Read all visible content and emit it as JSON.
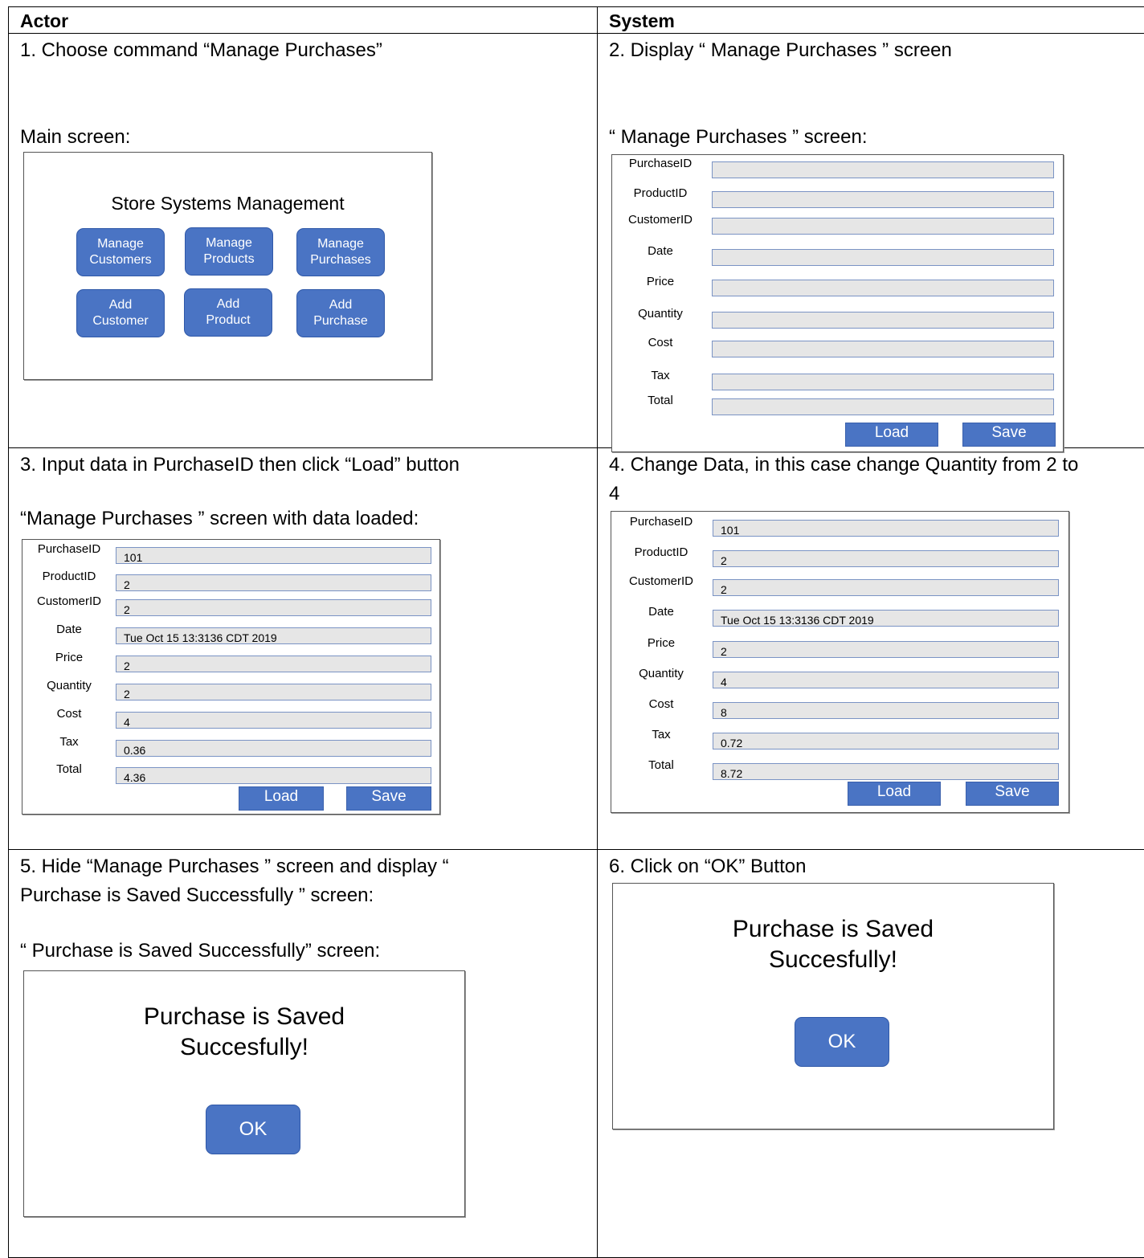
{
  "headers": {
    "actor": "Actor",
    "system": "System"
  },
  "steps": {
    "s1": "1. Choose command “Manage Purchases”",
    "s2": "2. Display “ Manage   Purchases ” screen",
    "s3": "3. Input data in PurchaseID then click “Load” button",
    "s4_line1": "4. Change Data, in this case change Quantity from 2 to",
    "s4_line2": "4",
    "s5_line1": "5. Hide “Manage   Purchases ” screen and display “",
    "s5_line2": "Purchase is Saved Successfully ” screen:",
    "s6": "6. Click on “OK” Button"
  },
  "captions": {
    "main": "Main screen:",
    "manage": "“ Manage   Purchases ” screen:",
    "loaded": "“Manage   Purchases ” screen with data loaded:",
    "saved": "“  Purchase is Saved Successfully” screen:"
  },
  "main_screen": {
    "title": "Store Systems Management",
    "buttons": {
      "manage_customers": "Manage\nCustomers",
      "manage_products": "Manage\nProducts",
      "manage_purchases": "Manage\nPurchases",
      "add_customer": "Add\nCustomer",
      "add_product": "Add\nProduct",
      "add_purchase": "Add\nPurchase"
    }
  },
  "form_labels": {
    "purchase_id": "PurchaseID",
    "product_id": "ProductID",
    "customer_id": "CustomerID",
    "date": "Date",
    "price": "Price",
    "quantity": "Quantity",
    "cost": "Cost",
    "tax": "Tax",
    "total": "Total",
    "load": "Load",
    "save": "Save"
  },
  "loaded_values": {
    "purchase_id": "101",
    "product_id": "2",
    "customer_id": "2",
    "date": "Tue Oct 15 13:3136 CDT 2019",
    "price": "2",
    "quantity": "2",
    "cost": "4",
    "tax": "0.36",
    "total": "4.36"
  },
  "changed_values": {
    "purchase_id": "101",
    "product_id": "2",
    "customer_id": "2",
    "date": "Tue Oct 15 13:3136 CDT 2019",
    "price": "2",
    "quantity": "4",
    "cost": "8",
    "tax": "0.72",
    "total": "8.72"
  },
  "saved_dialog": {
    "line1": "Purchase is Saved",
    "line2": "Succesfully!",
    "ok": "OK"
  }
}
